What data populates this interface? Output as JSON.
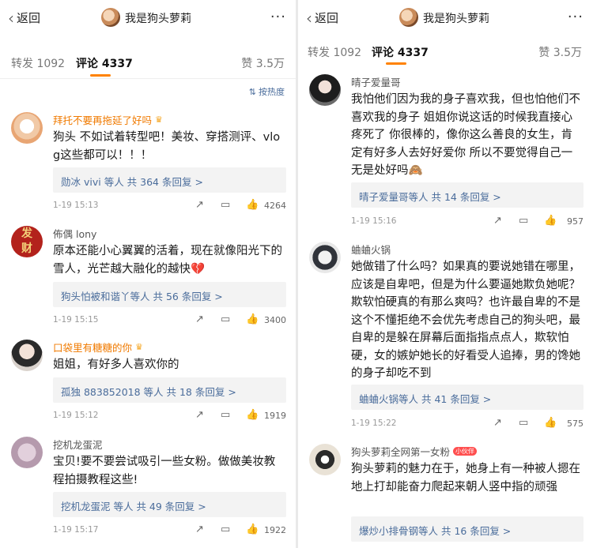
{
  "nav": {
    "back_label": "返回",
    "title": "我是狗头萝莉",
    "more_icon": "more-dots-icon"
  },
  "tabs": {
    "repost": "转发 1092",
    "comments": "评论 4337",
    "likes": "赞 3.5万",
    "accent_color": "#ff8200"
  },
  "sort": {
    "label": "按热度",
    "icon": "sort-icon"
  },
  "left_comments": [
    {
      "user": "拜托不要再拖延了好吗",
      "vip": true,
      "text": "狗头 不如试着转型吧！美妆、穿搭测评、vlog这些都可以！！！",
      "reply": "勋冰 vivi 等人  共 364 条回复 >",
      "time": "1-19 15:13",
      "likes": "4264"
    },
    {
      "user": "佈偶 lony",
      "vip": false,
      "avatar_text": "发\n财",
      "text": "原本还能小心翼翼的活着，现在就像阳光下的雪人，光芒越大融化的越快💔",
      "reply": "狗头怕被和谐丫等人  共 56 条回复 >",
      "time": "1-19 15:15",
      "likes": "3400"
    },
    {
      "user": "口袋里有糖糖的你",
      "vip": true,
      "text": "姐姐，有好多人喜欢你的",
      "reply": "孤独 883852018 等人  共 18 条回复 >",
      "time": "1-19 15:12",
      "likes": "1919"
    },
    {
      "user": "挖机龙蛋泥",
      "vip": false,
      "text": "宝贝!要不要尝试吸引一些女粉。做做美妆教程拍摄教程这些!",
      "reply": "挖机龙蛋泥 等人  共 49 条回复 >",
      "time": "1-19 15:17",
      "likes": "1922"
    }
  ],
  "right_comments": [
    {
      "user": "晴子爱量哥",
      "vip": false,
      "text": "我怕他们因为我的身子喜欢我，但也怕他们不喜欢我的身子 姐姐你说这话的时候我直接心疼死了 你很棒的，像你这么善良的女生，肯定有好多人去好好爱你 所以不要觉得自己一无是处好吗🙈",
      "reply": "晴子爱量哥等人  共 14 条回复 >",
      "time": "1-19 15:16",
      "likes": "957"
    },
    {
      "user": "蛐蛐火锅",
      "vip": false,
      "text": "她做错了什么吗？如果真的要说她错在哪里，应该是自卑吧，但是为什么要逼她欺负她呢？欺软怕硬真的有那么爽吗？也许最自卑的不是这个不懂拒绝不会优先考虑自己的狗头吧，最自卑的是躲在屏幕后面指指点点人，欺软怕硬，女的嫉妒她长的好看受人追捧，男的馋她的身子却吃不到",
      "reply": "蛐蛐火锅等人  共 41 条回复 >",
      "time": "1-19 15:22",
      "likes": "575"
    },
    {
      "user": "狗头萝莉全网第一女粉",
      "vip": false,
      "badge": "小伙伴",
      "text": "狗头萝莉的魅力在于，她身上有一种被人摁在地上打却能奋力爬起来朝人竖中指的顽强",
      "reply": "爆炒小排骨钢等人  共 16 条回复 >",
      "time": "",
      "likes": ""
    }
  ],
  "icons": {
    "share": "share-icon",
    "comment": "comment-icon",
    "like": "like-icon"
  }
}
